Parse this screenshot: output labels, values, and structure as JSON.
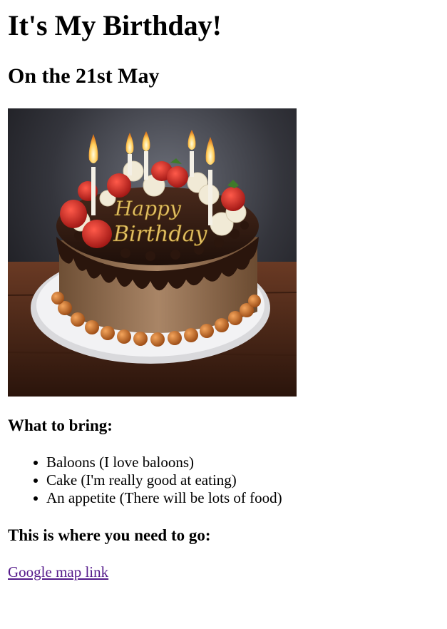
{
  "page": {
    "title": "It's My Birthday!",
    "subtitle": "On the 21st May"
  },
  "photo": {
    "cake_text_line1": "Happy",
    "cake_text_line2": "Birthday"
  },
  "bring": {
    "heading": "What to bring:",
    "items": [
      {
        "label": "Baloons (I love baloons)"
      },
      {
        "label": "Cake (I'm really good at eating)"
      },
      {
        "label": "An appetite (There will be lots of food)"
      }
    ]
  },
  "directions": {
    "heading": "This is where you need to go:",
    "link_label": "Google map link"
  },
  "colors": {
    "visited_link": "#551a8b",
    "text": "#000000",
    "background": "#ffffff"
  }
}
